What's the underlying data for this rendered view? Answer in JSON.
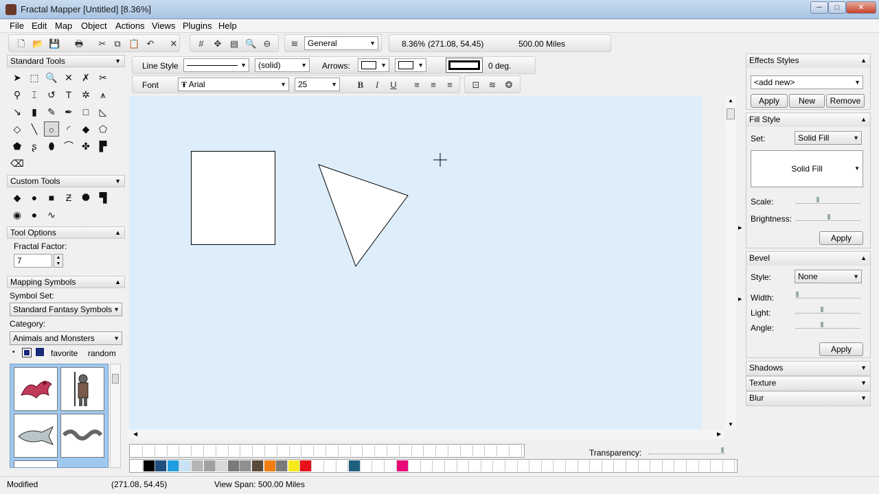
{
  "window": {
    "title": "Fractal Mapper [Untitled] [8.36%]",
    "minimize": "─",
    "maximize": "□",
    "close": "✕"
  },
  "menu": [
    "File",
    "Edit",
    "Map",
    "Object",
    "Actions",
    "Views",
    "Plugins",
    "Help"
  ],
  "toolbar": {
    "layer_select": "General",
    "zoom_readout": "8.36%",
    "coords_readout": "(271.08, 54.45)",
    "span_readout": "500.00 Miles"
  },
  "line_toolbar": {
    "line_style_label": "Line Style",
    "line_pattern_value": "(solid)",
    "arrows_label": "Arrows:",
    "angle_value": "0 deg."
  },
  "font_toolbar": {
    "font_label": "Font",
    "font_value": "Arial",
    "size_value": "25",
    "bold": "B",
    "italic": "I",
    "underline": "U"
  },
  "left_panel": {
    "standard_tools_title": "Standard Tools",
    "custom_tools_title": "Custom Tools",
    "tool_options_title": "Tool Options",
    "fractal_factor_label": "Fractal Factor:",
    "fractal_factor_value": "7",
    "mapping_symbols_title": "Mapping Symbols",
    "symbol_set_label": "Symbol Set:",
    "symbol_set_value": "Standard Fantasy Symbols",
    "category_label": "Category:",
    "category_value": "Animals and Monsters",
    "favorite_label": "favorite",
    "random_label": "random"
  },
  "right_panel": {
    "effects_styles_title": "Effects Styles",
    "add_new_value": "<add new>",
    "apply_label": "Apply",
    "new_label": "New",
    "remove_label": "Remove",
    "fill_style_title": "Fill Style",
    "set_label": "Set:",
    "set_value": "Solid Fill",
    "fill_preview_value": "Solid Fill",
    "scale_label": "Scale:",
    "brightness_label": "Brightness:",
    "fill_apply_label": "Apply",
    "bevel_title": "Bevel",
    "style_label": "Style:",
    "style_value": "None",
    "width_label": "Width:",
    "light_label": "Light:",
    "angle_label": "Angle:",
    "bevel_apply_label": "Apply",
    "shadows_title": "Shadows",
    "texture_title": "Texture",
    "blur_title": "Blur"
  },
  "palette": {
    "transparency_label": "Transparency:",
    "colors": [
      "#000000",
      "#1f4f7f",
      "#1e9de0",
      "#c7e3f5",
      "#b5b5b5",
      "#a0a0a0",
      "#d8d8d8",
      "#7a7a7a",
      "#909090",
      "#5a4a3a",
      "#f07d10",
      "#7a7a7a",
      "#f6e81a",
      "#e8101a",
      "#ffffff",
      "#ffffff",
      "#ffffff",
      "#1f5f7f",
      "#ffffff",
      "#ffffff",
      "#ffffff",
      "#e80a78"
    ]
  },
  "statusbar": {
    "state": "Modified",
    "coords": "(271.08, 54.45)",
    "view_span": "View Span: 500.00 Miles"
  }
}
